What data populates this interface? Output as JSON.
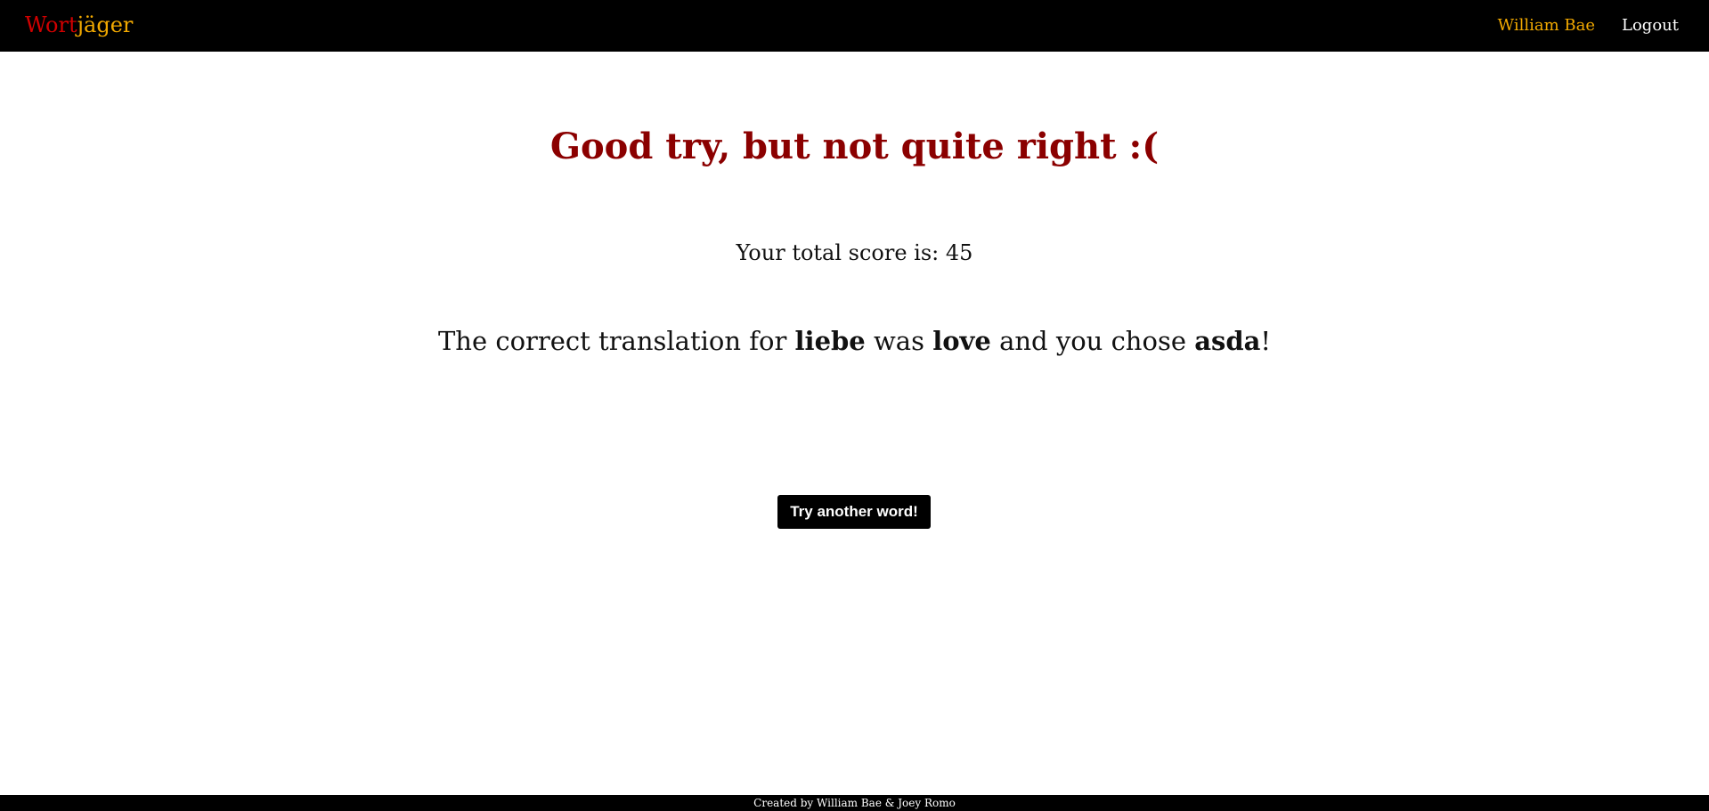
{
  "navbar": {
    "brand_part_1": "Wort",
    "brand_part_2": "jäger",
    "user_name": "William Bae",
    "logout_label": "Logout"
  },
  "result": {
    "title": "Good try, but not quite right :(",
    "score_prefix": "Your total score is: ",
    "score": "45",
    "translation_prefix": "The correct translation for ",
    "word": "liebe",
    "translation_mid": " was ",
    "correct_answer": "love",
    "translation_mid2": " and you chose ",
    "user_answer": "asda",
    "translation_suffix": "!"
  },
  "actions": {
    "try_again_label": "Try another word!"
  },
  "footer": {
    "credits": "Created by William Bae & Joey Romo"
  },
  "colors": {
    "brand_red": "#d10000",
    "brand_gold": "#f2a900",
    "title_red": "#8b0000",
    "nav_background": "#000000"
  }
}
